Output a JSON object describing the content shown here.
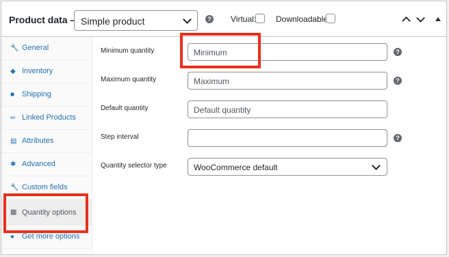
{
  "header": {
    "title": "Product data —",
    "product_type": "Simple product",
    "virtual_label": "Virtual:",
    "downloadable_label": "Downloadable:",
    "help_glyph": "?"
  },
  "sidebar": {
    "items": [
      {
        "label": "General",
        "icon": "wrench-icon",
        "glyph": "🔧"
      },
      {
        "label": "Inventory",
        "icon": "tag-icon",
        "glyph": "◆"
      },
      {
        "label": "Shipping",
        "icon": "truck-icon",
        "glyph": "■"
      },
      {
        "label": "Linked Products",
        "icon": "link-icon",
        "glyph": "∞"
      },
      {
        "label": "Attributes",
        "icon": "list-icon",
        "glyph": "▤"
      },
      {
        "label": "Advanced",
        "icon": "gear-icon",
        "glyph": "✱"
      },
      {
        "label": "Custom fields",
        "icon": "wrench-icon",
        "glyph": "🔧"
      },
      {
        "label": "Quantity options",
        "icon": "quantity-icon",
        "glyph": "▦",
        "active": true
      },
      {
        "label": "Get more options",
        "icon": "plug-icon",
        "glyph": "●"
      }
    ]
  },
  "fields": {
    "minimum": {
      "label": "Minimum quantity",
      "placeholder": "Minimum"
    },
    "maximum": {
      "label": "Maximum quantity",
      "placeholder": "Maximum"
    },
    "default": {
      "label": "Default quantity",
      "placeholder": "Default quantity"
    },
    "step": {
      "label": "Step interval",
      "placeholder": ""
    },
    "selector": {
      "label": "Quantity selector type",
      "value": "WooCommerce default"
    }
  },
  "colors": {
    "highlight": "#e8301d",
    "link": "#2271b1"
  }
}
